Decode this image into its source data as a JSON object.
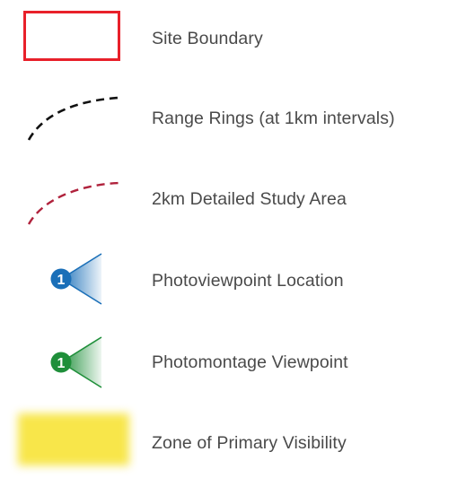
{
  "legend": {
    "items": [
      {
        "id": "site-boundary",
        "label": "Site Boundary",
        "symbol": "red-rectangle",
        "color": "#e8202a"
      },
      {
        "id": "range-rings",
        "label": "Range Rings (at 1km intervals)",
        "symbol": "dashed-arc",
        "color": "#111111"
      },
      {
        "id": "detailed-study-area",
        "label": "2km Detailed Study Area",
        "symbol": "dashed-arc",
        "color": "#b0223c"
      },
      {
        "id": "photoviewpoint-location",
        "label": "Photoviewpoint Location",
        "symbol": "viewpoint-marker",
        "color": "#1a6fb8",
        "number": "1"
      },
      {
        "id": "photomontage-viewpoint",
        "label": "Photomontage Viewpoint",
        "symbol": "viewpoint-marker",
        "color": "#1f8f3a",
        "number": "1"
      },
      {
        "id": "zone-primary-visibility",
        "label": "Zone of Primary Visibility",
        "symbol": "yellow-blur",
        "color": "#f8e64a"
      }
    ]
  }
}
